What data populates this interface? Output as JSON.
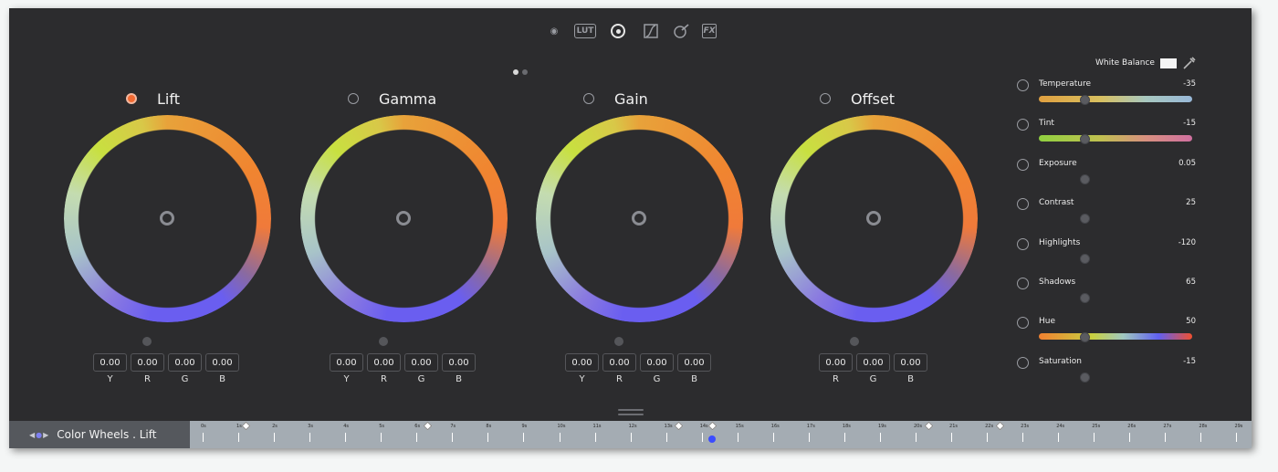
{
  "toolbar": {
    "tools": [
      {
        "name": "camera-raw-icon",
        "glyph": "◉"
      },
      {
        "name": "lut-icon",
        "glyph": "LUT"
      },
      {
        "name": "color-wheels-icon",
        "glyph": ""
      },
      {
        "name": "curves-icon",
        "glyph": "∫"
      },
      {
        "name": "qualifier-icon",
        "glyph": "✎"
      },
      {
        "name": "fx-icon",
        "glyph": "FX"
      }
    ],
    "active": "color-wheels-icon"
  },
  "wheels": [
    {
      "title": "Lift",
      "active": true,
      "values": [
        "0.00",
        "0.00",
        "0.00",
        "0.00"
      ],
      "labels": [
        "Y",
        "R",
        "G",
        "B"
      ]
    },
    {
      "title": "Gamma",
      "active": false,
      "values": [
        "0.00",
        "0.00",
        "0.00",
        "0.00"
      ],
      "labels": [
        "Y",
        "R",
        "G",
        "B"
      ]
    },
    {
      "title": "Gain",
      "active": false,
      "values": [
        "0.00",
        "0.00",
        "0.00",
        "0.00"
      ],
      "labels": [
        "Y",
        "R",
        "G",
        "B"
      ]
    },
    {
      "title": "Offset",
      "active": false,
      "values": [
        "0.00",
        "0.00",
        "0.00"
      ],
      "labels": [
        "R",
        "G",
        "B"
      ]
    }
  ],
  "white_balance": {
    "label": "White Balance"
  },
  "adjustments": [
    {
      "label": "Temperature",
      "value": "-35",
      "slider": "temperature",
      "position": 0.3
    },
    {
      "label": "Tint",
      "value": "-15",
      "slider": "tint",
      "position": 0.3
    },
    {
      "label": "Exposure",
      "value": "0.05",
      "slider": "none",
      "position": 0.3
    },
    {
      "label": "Contrast",
      "value": "25",
      "slider": "none",
      "position": 0.3
    },
    {
      "label": "Highlights",
      "value": "-120",
      "slider": "none",
      "position": 0.3
    },
    {
      "label": "Shadows",
      "value": "65",
      "slider": "none",
      "position": 0.3
    },
    {
      "label": "Hue",
      "value": "50",
      "slider": "hue",
      "position": 0.3
    },
    {
      "label": "Saturation",
      "value": "-15",
      "slider": "none",
      "position": 0.3
    }
  ],
  "bottom_bar": {
    "arrows": "◀ ● ▶",
    "title": "Color Wheels . Lift",
    "ticks": [
      "0s",
      "1s",
      "2s",
      "3s",
      "4s",
      "5s",
      "6s",
      "7s",
      "8s",
      "9s",
      "10s",
      "11s",
      "12s",
      "13s",
      "14s",
      "15s",
      "16s",
      "17s",
      "18s",
      "19s",
      "20s",
      "21s",
      "22s",
      "23s",
      "24s",
      "25s",
      "26s",
      "27s",
      "28s",
      "29s"
    ],
    "keyframes_at": [
      1.2,
      6.3,
      13.35,
      14.3,
      20.35,
      22.35
    ],
    "playhead_at": 14.3
  },
  "colors": {
    "accent": "#f26a32",
    "panel": "#2c2c2e",
    "playhead": "#3b4cff"
  }
}
